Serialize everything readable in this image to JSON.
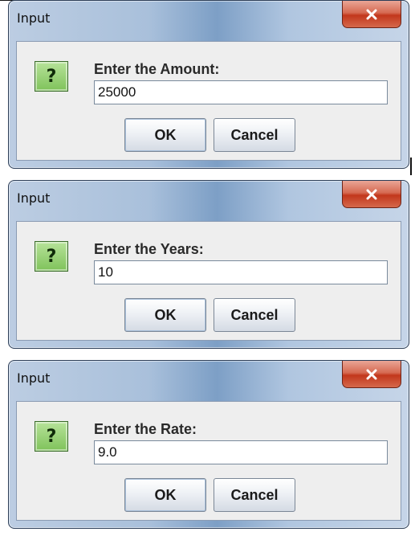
{
  "dialogs": [
    {
      "title": "Input",
      "prompt": "Enter the Amount:",
      "value": "25000",
      "ok_label": "OK",
      "cancel_label": "Cancel",
      "icon": "question-icon",
      "icon_glyph": "?"
    },
    {
      "title": "Input",
      "prompt": "Enter the Years:",
      "value": "10",
      "ok_label": "OK",
      "cancel_label": "Cancel",
      "icon": "question-icon",
      "icon_glyph": "?"
    },
    {
      "title": "Input",
      "prompt": "Enter the Rate:",
      "value": "9.0",
      "ok_label": "OK",
      "cancel_label": "Cancel",
      "icon": "question-icon",
      "icon_glyph": "?"
    }
  ],
  "close_icon": "close-icon",
  "colors": {
    "close_button": "#c2371c",
    "question_icon": "#7fc25a",
    "content_bg": "#eeeeee"
  }
}
